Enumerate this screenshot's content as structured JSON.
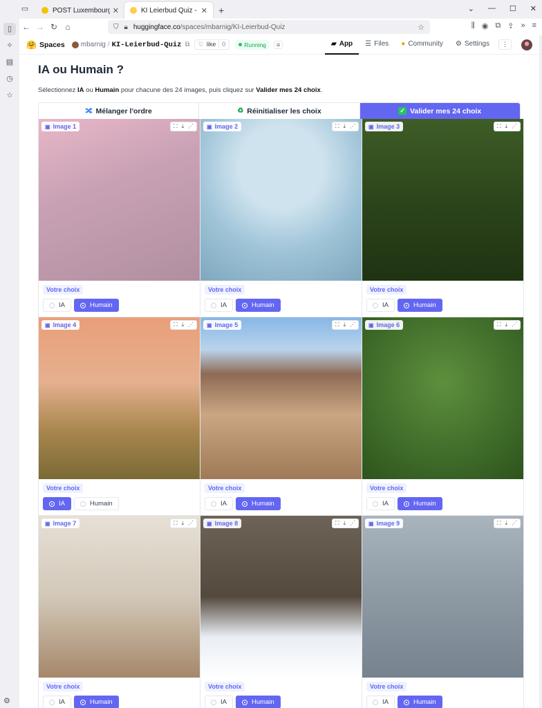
{
  "browser": {
    "tabs": [
      {
        "title": "POST Luxembourg",
        "favicon_color": "#f5c400"
      },
      {
        "title": "KI Leierbud Quiz - a Hugging Face",
        "favicon_color": "#ffcc4d"
      }
    ],
    "url_host": "huggingface.co",
    "url_path": "/spaces/mbarnig/KI-Leierbud-Quiz"
  },
  "hf": {
    "spaces_label": "Spaces",
    "owner": "mbarnig",
    "repo": "KI-Leierbud-Quiz",
    "like_label": "like",
    "like_count": "0",
    "status": "Running",
    "tabs": {
      "app": "App",
      "files": "Files",
      "community": "Community",
      "settings": "Settings"
    }
  },
  "app": {
    "title": "IA ou Humain ?",
    "instruction_pre": "Sélectionnez ",
    "instruction_ia": "IA",
    "instruction_mid1": " ou ",
    "instruction_humain": "Humain",
    "instruction_mid2": " pour chacune des 24 images, puis cliquez sur ",
    "instruction_validate": "Valider mes 24 choix",
    "instruction_end": ".",
    "buttons": {
      "shuffle": "Mélanger l'ordre",
      "reset": "Réinitialiser les choix",
      "validate": "Valider mes 24 choix"
    },
    "choice_label": "Votre choix",
    "option_ia": "IA",
    "option_humain": "Humain",
    "images": [
      {
        "label": "Image 1",
        "selected": "Humain"
      },
      {
        "label": "Image 2",
        "selected": "Humain"
      },
      {
        "label": "Image 3",
        "selected": "Humain"
      },
      {
        "label": "Image 4",
        "selected": "IA"
      },
      {
        "label": "Image 5",
        "selected": "Humain"
      },
      {
        "label": "Image 6",
        "selected": "Humain"
      },
      {
        "label": "Image 7",
        "selected": "Humain"
      },
      {
        "label": "Image 8",
        "selected": "Humain"
      },
      {
        "label": "Image 9",
        "selected": "Humain"
      }
    ]
  }
}
